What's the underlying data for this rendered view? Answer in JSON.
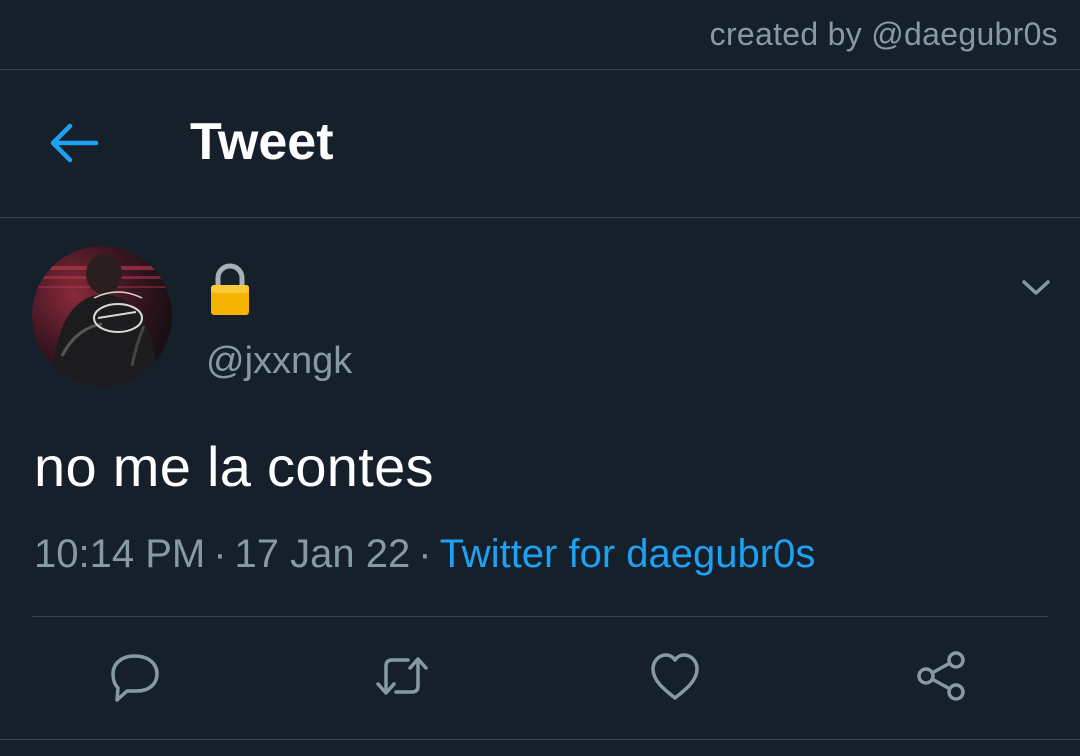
{
  "credit": {
    "text": "created by @daegubr0s"
  },
  "header": {
    "title": "Tweet",
    "back_icon": "arrow-left-icon"
  },
  "tweet": {
    "name_icon": "lock-icon",
    "handle": "@jxxngk",
    "text": "no me la contes",
    "time": "10:14 PM",
    "separator": "·",
    "date": "17 Jan 22",
    "source": "Twitter for daegubr0s",
    "menu_icon": "chevron-down-icon"
  },
  "actions": [
    {
      "name": "reply",
      "icon": "reply-icon"
    },
    {
      "name": "retweet",
      "icon": "retweet-icon"
    },
    {
      "name": "like",
      "icon": "heart-icon"
    },
    {
      "name": "share",
      "icon": "share-icon"
    }
  ],
  "colors": {
    "background": "#15202b",
    "divider": "#38444d",
    "secondary_text": "#8899a6",
    "accent": "#1da1f2",
    "primary_text": "#ffffff"
  }
}
